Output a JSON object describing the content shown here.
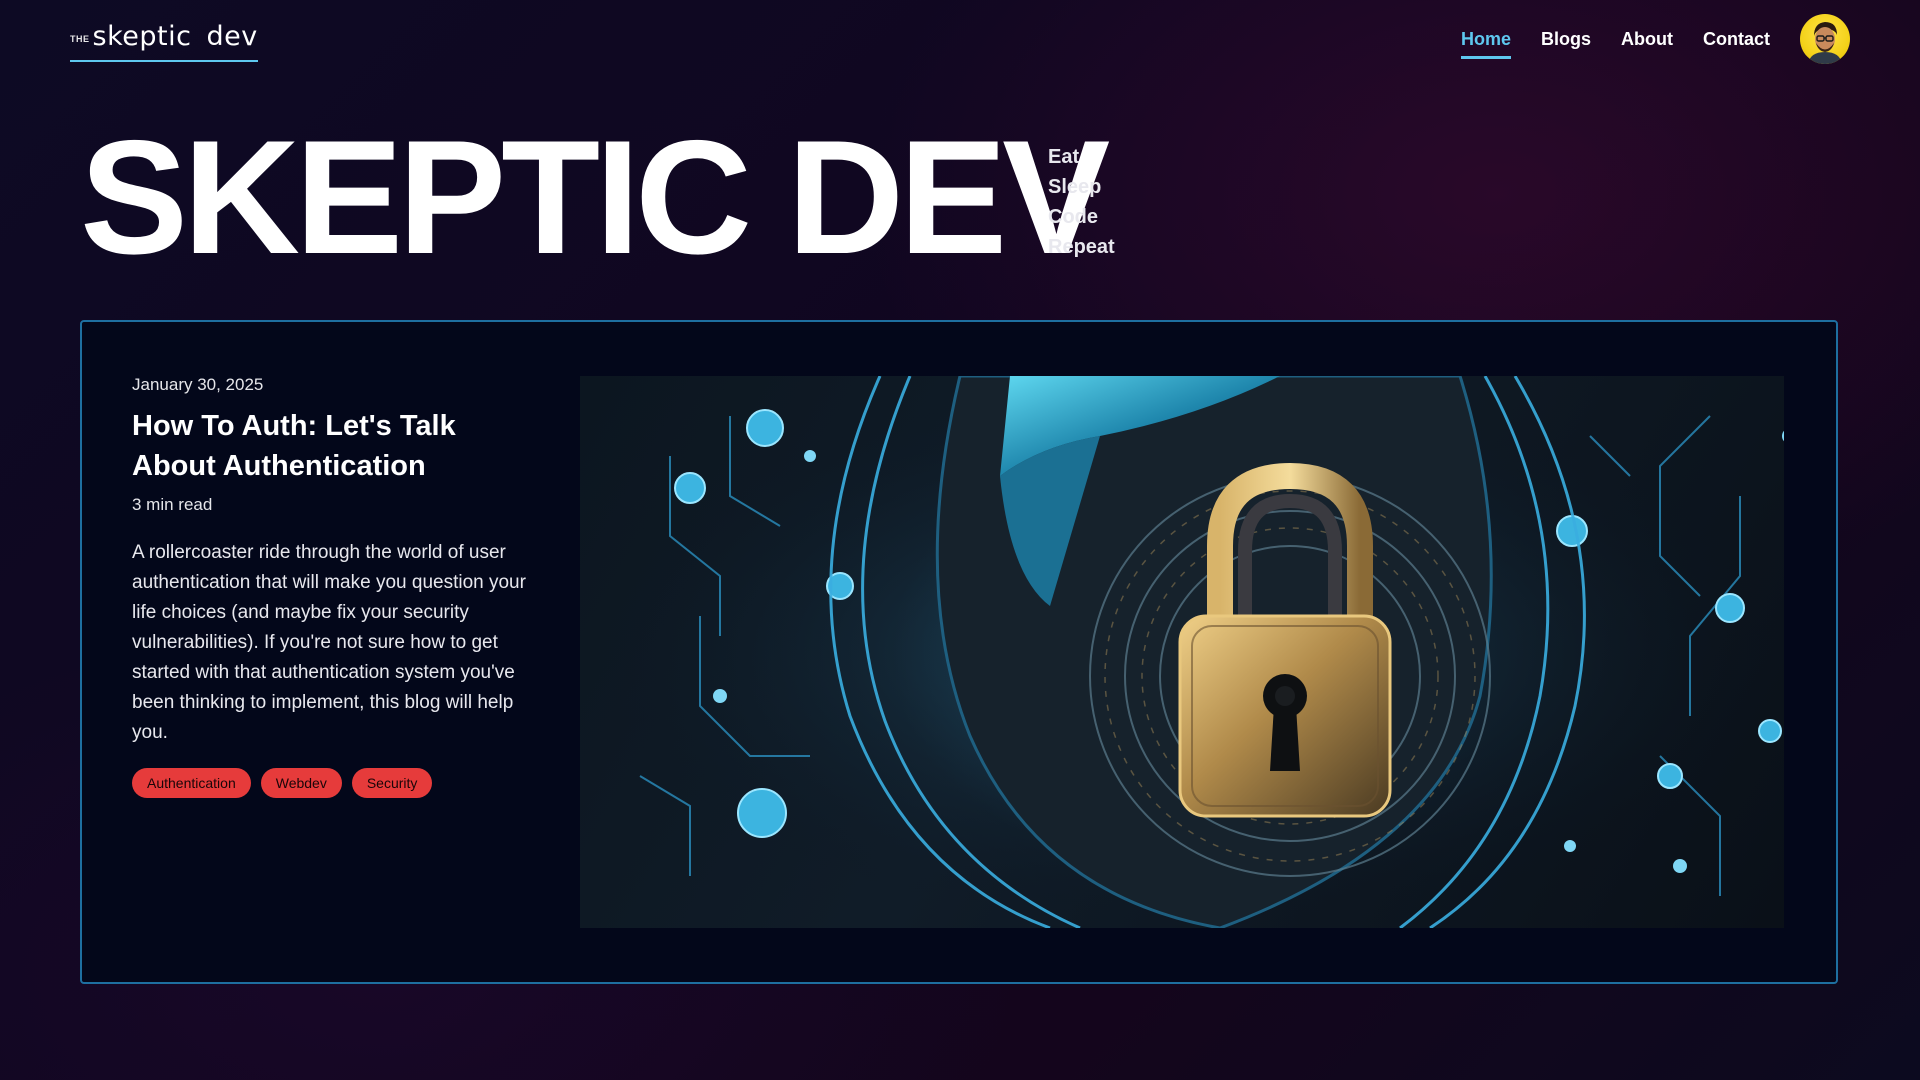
{
  "header": {
    "logo_small": "THE",
    "logo_main": "skeptic dev",
    "nav": [
      {
        "label": "Home",
        "active": true
      },
      {
        "label": "Blogs",
        "active": false
      },
      {
        "label": "About",
        "active": false
      },
      {
        "label": "Contact",
        "active": false
      }
    ],
    "avatar_icon": "user-avatar"
  },
  "hero": {
    "title": "SKEPTIC DEV",
    "motto": [
      "Eat",
      "Sleep",
      "Code",
      "Repeat"
    ]
  },
  "featured_post": {
    "date": "January 30, 2025",
    "title": "How To Auth: Let's Talk About Authentication",
    "read_time": "3 min read",
    "excerpt": "A rollercoaster ride through the world of user authentication that will make you question your life choices (and maybe fix your security vulnerabilities). If you're not sure how to get started with that authentication system you've been thinking to implement, this blog will help you.",
    "tags": [
      "Authentication",
      "Webdev",
      "Security"
    ],
    "image_icon": "padlock-shield-icon"
  },
  "colors": {
    "accent": "#5ec8ef",
    "card_border": "#1e6fa0",
    "tag_bg": "#e63b3b",
    "background": "#110620"
  }
}
